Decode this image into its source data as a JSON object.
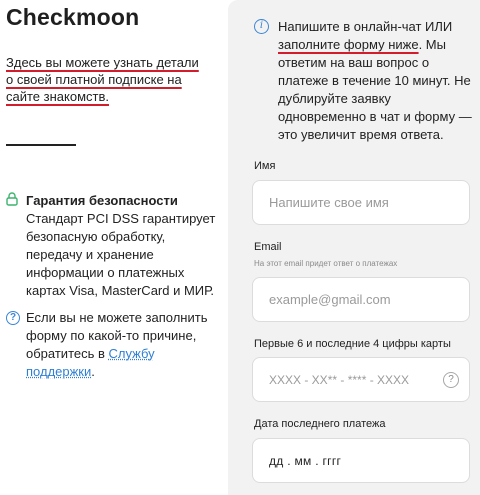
{
  "brand": "Checkmoon",
  "intro": "Здесь вы можете узнать детали о своей платной подписке на сайте знакомств.",
  "guarantee": {
    "title": "Гарантия безопасности",
    "body": "Стандарт PCI DSS гарантирует безопасную обработку, передачу и хранение информации о платежных картах Visa, MasterCard и МИР."
  },
  "support": {
    "text": "Если вы не можете заполнить форму по какой-то причине, обратитесь в ",
    "link": "Службу поддержки",
    "suffix": "."
  },
  "info": {
    "before": "Напишите в онлайн-чат ИЛИ ",
    "link": "заполните форму ниже",
    "after": ". Мы ответим на ваш вопрос о платеже в течение 10 минут. Не дублируйте заявку одновременно в чат и форму — это увеличит время ответа."
  },
  "form": {
    "name_label": "Имя",
    "name_placeholder": "Напишите свое имя",
    "email_label": "Email",
    "email_hint": "На этот email придет ответ о платежах",
    "email_placeholder": "example@gmail.com",
    "card_label": "Первые 6 и последние 4 цифры карты",
    "card_placeholder": "XXXX - XX** - **** - XXXX",
    "date_label": "Дата последнего платежа",
    "date_value": "дд . мм . гггг"
  }
}
